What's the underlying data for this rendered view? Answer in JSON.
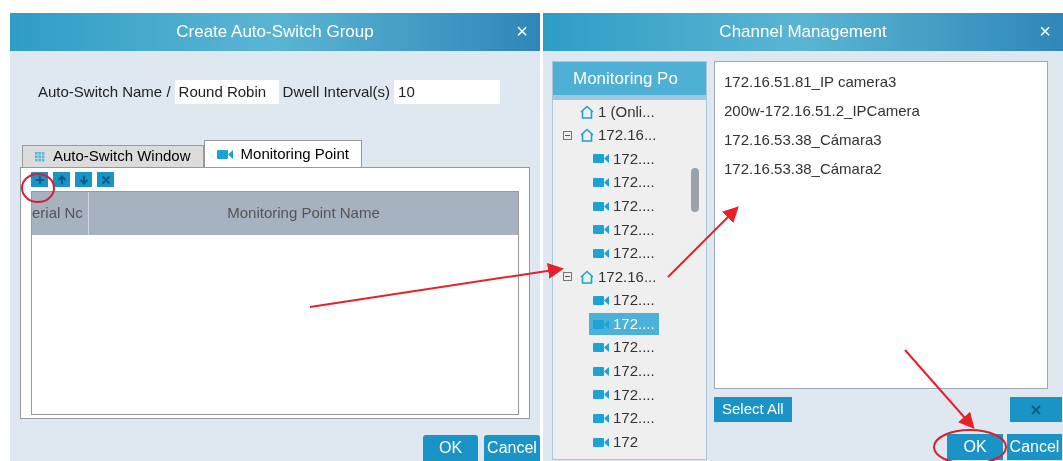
{
  "create_dialog": {
    "title": "Create Auto-Switch Group",
    "close": "×",
    "fields": [
      {
        "label": "Auto-Switch Name /",
        "value": "Round Robin"
      },
      {
        "label": "Dwell Interval(s)",
        "value": "10"
      }
    ],
    "tabs": [
      {
        "label": "Auto-Switch Window",
        "selected": false,
        "kind": "grid"
      },
      {
        "label": "Monitoring Point",
        "selected": true,
        "kind": "camera"
      }
    ],
    "toolbar": [
      {
        "kind": "add"
      },
      {
        "kind": "up"
      },
      {
        "kind": "down"
      },
      {
        "kind": "delete"
      }
    ],
    "table": {
      "columns": [
        "erial Nc",
        "Monitoring Point Name"
      ]
    },
    "buttons": [
      "OK",
      "Cancel"
    ]
  },
  "channel_dialog": {
    "title": "Channel Management",
    "close": "×",
    "tree_header": "Monitoring Po",
    "tree": [
      {
        "kind": "host",
        "label": "1 (Onli...",
        "selected": false
      },
      {
        "kind": "host",
        "label": "172.16...",
        "expanded": true,
        "selected": false,
        "children": [
          {
            "kind": "camera",
            "label": "172....",
            "selected": false
          },
          {
            "kind": "camera",
            "label": "172....",
            "selected": false
          },
          {
            "kind": "camera",
            "label": "172....",
            "selected": false
          },
          {
            "kind": "camera",
            "label": "172....",
            "selected": false
          },
          {
            "kind": "camera",
            "label": "172....",
            "selected": false
          }
        ]
      },
      {
        "kind": "host",
        "label": "172.16...",
        "expanded": true,
        "selected": false,
        "children": [
          {
            "kind": "camera",
            "label": "172....",
            "selected": false
          },
          {
            "kind": "camera",
            "label": "172....",
            "selected": true
          },
          {
            "kind": "camera",
            "label": "172....",
            "selected": false
          },
          {
            "kind": "camera",
            "label": "172....",
            "selected": false
          },
          {
            "kind": "camera",
            "label": "172....",
            "selected": false
          },
          {
            "kind": "camera",
            "label": "172....",
            "selected": false
          },
          {
            "kind": "camera",
            "label": "172",
            "selected": false
          }
        ]
      }
    ],
    "channels": [
      "172.16.51.81_IP camera3",
      "200w-172.16.51.2_IPCamera",
      "172.16.53.38_Cámara3",
      "172.16.53.38_Cámara2"
    ],
    "select_all": "Select All",
    "buttons": [
      "OK",
      "Cancel"
    ]
  }
}
